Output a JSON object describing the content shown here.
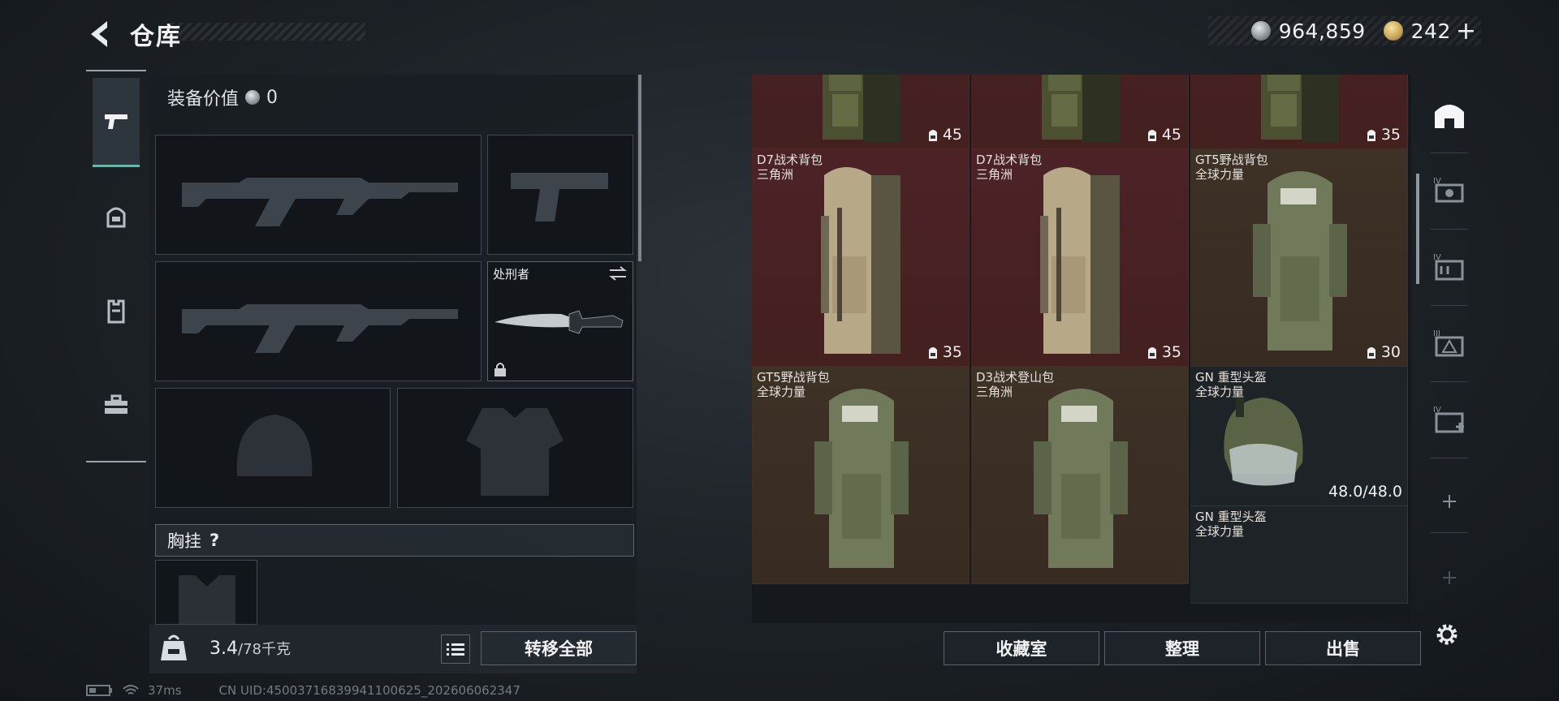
{
  "header": {
    "title": "仓库",
    "currency_silver": "964,859",
    "currency_gold": "242",
    "plus_label": "+"
  },
  "equipment": {
    "value_label": "装备价值",
    "value": "0",
    "melee_name": "处刑者",
    "chest_rig_label": "胸挂",
    "help_label": "?"
  },
  "footer_left": {
    "weight_current": "3.4",
    "weight_max": "/78千克",
    "transfer_all_label": "转移全部"
  },
  "status": {
    "ping": "37ms",
    "uid": "CN UID:45003716839941100625_202606062347"
  },
  "stash": {
    "items": [
      {
        "name": "",
        "sub": "",
        "count": "45",
        "bg": "red",
        "kind": "small-pack"
      },
      {
        "name": "",
        "sub": "",
        "count": "45",
        "bg": "red",
        "kind": "small-pack"
      },
      {
        "name": "",
        "sub": "",
        "count": "35",
        "bg": "red",
        "kind": "small-pack"
      },
      {
        "name": "D7战术背包",
        "sub": "三角洲",
        "count": "35",
        "bg": "red",
        "kind": "tan-pack"
      },
      {
        "name": "D7战术背包",
        "sub": "三角洲",
        "count": "35",
        "bg": "red",
        "kind": "tan-pack"
      },
      {
        "name": "GT5野战背包",
        "sub": "全球力量",
        "count": "30",
        "bg": "brown",
        "kind": "green-pack"
      },
      {
        "name": "GT5野战背包",
        "sub": "全球力量",
        "count": "",
        "bg": "brown",
        "kind": "green-pack"
      },
      {
        "name": "D3战术登山包",
        "sub": "三角洲",
        "count": "",
        "bg": "brown",
        "kind": "green-pack"
      },
      {
        "name": "GN 重型头盔",
        "sub": "全球力量",
        "count": "",
        "durability": "48.0/48.0",
        "bg": "dark",
        "kind": "helmet"
      }
    ],
    "partial_item": {
      "name": "GN 重型头盔",
      "sub": "全球力量"
    }
  },
  "footer_right": {
    "collection_label": "收藏室",
    "sort_label": "整理",
    "sell_label": "出售"
  },
  "colors": {
    "accent": "#42c9b0",
    "rare_bg": "#4c2226",
    "epic_bg": "#3e3227"
  }
}
